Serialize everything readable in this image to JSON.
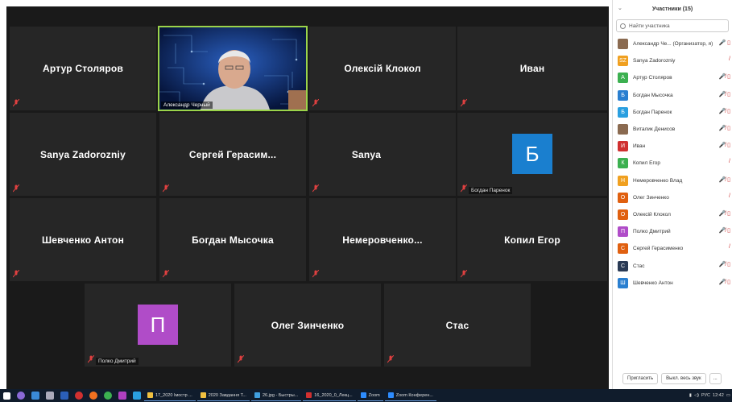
{
  "gallery": {
    "tiles": [
      {
        "name": "Артур Столяров"
      },
      {
        "video_label": "Александр Черный"
      },
      {
        "name": "Олексій Клокол"
      },
      {
        "name": "Иван"
      },
      {
        "name": "Sanya Zadorozniy"
      },
      {
        "name": "Сергей  Герасим..."
      },
      {
        "name": "Sanya"
      },
      {
        "avatar_letter": "Б",
        "label": "Богдан Паренок",
        "color": "#1a7fcf"
      },
      {
        "name": "Шевченко Антон"
      },
      {
        "name": "Богдан Мысочка"
      },
      {
        "name": "Немеровченко..."
      },
      {
        "name": "Копил Егор"
      },
      {
        "avatar_letter": "П",
        "label": "Полко Дмитрий",
        "color": "#b04cc8"
      },
      {
        "name": "Олег Зинченко"
      },
      {
        "name": "Стас"
      }
    ]
  },
  "panel": {
    "title": "Участники (15)",
    "search_placeholder": "Найти участника",
    "participants": [
      {
        "initial": "",
        "name": "Александр Че... (Организатор, я)",
        "color": "#8a6a50",
        "icons": "🎤 ▯"
      },
      {
        "initial": "SZ",
        "name": "Sanya Zadorozniy",
        "color": "#f0a020",
        "icons": "/"
      },
      {
        "initial": "A",
        "name": "Артур Столяров",
        "color": "#3cb050",
        "icons": "🎤̸ ▯"
      },
      {
        "initial": "Б",
        "name": "Богдан Мысочка",
        "color": "#2a7fd0",
        "icons": "🎤̸ ▯"
      },
      {
        "initial": "Б",
        "name": "Богдан Паренок",
        "color": "#2a9fe0",
        "icons": "🎤̸ ▯"
      },
      {
        "initial": "",
        "name": "Виталик Денисов",
        "color": "#8a6a50",
        "icons": "🎤̸ ▯"
      },
      {
        "initial": "И",
        "name": "Иван",
        "color": "#d03030",
        "icons": "🎤̸ ▯"
      },
      {
        "initial": "К",
        "name": "Копил Егор",
        "color": "#3cb050",
        "icons": "/"
      },
      {
        "initial": "Н",
        "name": "Немеровченко Влад",
        "color": "#f0a020",
        "icons": "🎤̸ ▯"
      },
      {
        "initial": "О",
        "name": "Олег Зинченко",
        "color": "#e06010",
        "icons": "/"
      },
      {
        "initial": "О",
        "name": "Олексій Клокол",
        "color": "#e06010",
        "icons": "🎤̸ ▯"
      },
      {
        "initial": "П",
        "name": "Полко Дмитрий",
        "color": "#b04cc8",
        "icons": "🎤̸ ▯"
      },
      {
        "initial": "С",
        "name": "Сергей Герасименко",
        "color": "#e06010",
        "icons": "/"
      },
      {
        "initial": "С",
        "name": "Стас",
        "color": "#2a3a55",
        "icons": "🎤̸ ▯"
      },
      {
        "initial": "Ш",
        "name": "Шевченко Антон",
        "color": "#2a7fd0",
        "icons": "🎤̸ ▯"
      }
    ],
    "invite_label": "Пригласить",
    "mute_all_label": "Выкл. весь звук",
    "more_label": "..."
  },
  "taskbar": {
    "tasks": [
      {
        "label": "17_2020 Імостр ...",
        "color": "#f0c040"
      },
      {
        "label": "2020 Завдання Т...",
        "color": "#f0c040"
      },
      {
        "label": "26.jpg - Быстры...",
        "color": "#40a0e0"
      },
      {
        "label": "16_2020_0_Лекц...",
        "color": "#d03030"
      },
      {
        "label": "Zoom",
        "color": "#2d8cff"
      },
      {
        "label": "Zoom Конферен...",
        "color": "#2d8cff"
      }
    ],
    "lang": "РУС",
    "time": "12:42"
  }
}
